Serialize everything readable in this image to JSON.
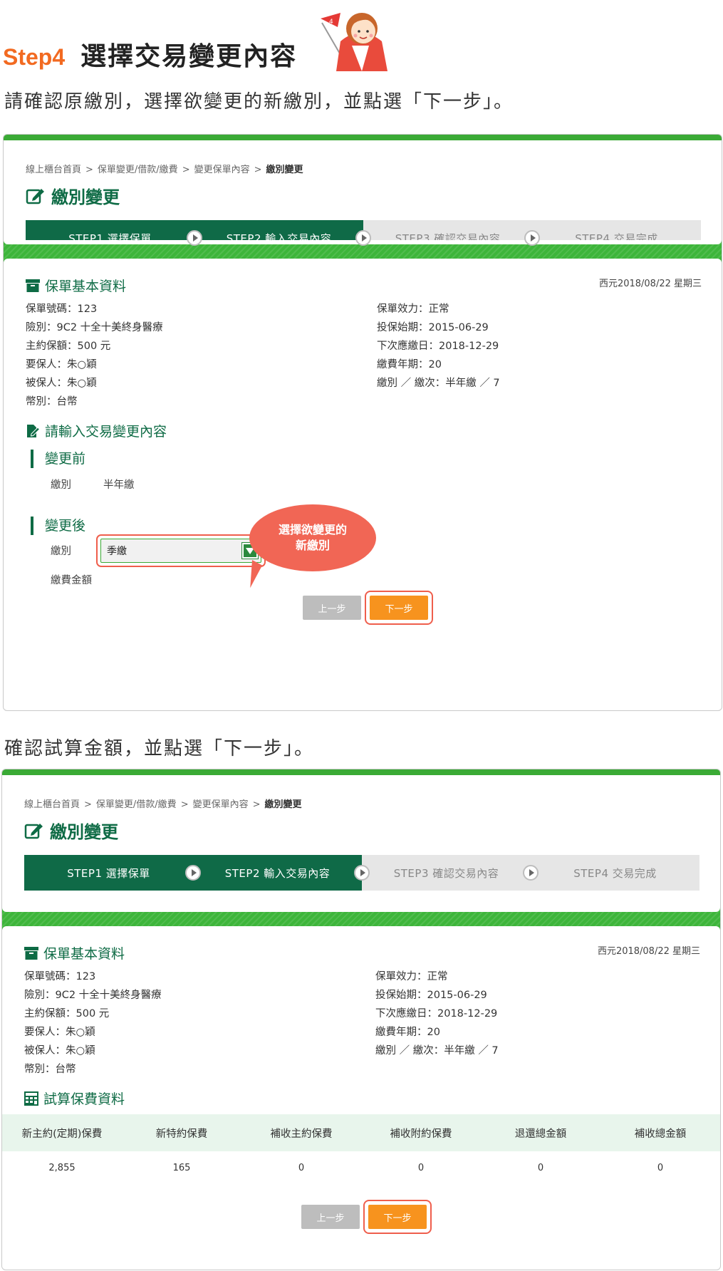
{
  "header": {
    "step_number": "Step4",
    "title": "選擇交易變更內容",
    "mascot_flag": "4"
  },
  "instructions": {
    "first": "請確認原繳別，選擇欲變更的新繳別，並點選「下一步」。",
    "second": "確認試算金額，並點選「下一步」。"
  },
  "breadcrumb": {
    "items": [
      "線上櫃台首頁",
      "保單變更/借款/繳費",
      "變更保單內容"
    ],
    "current": "繳別變更",
    "separator": ">"
  },
  "page_title": "繳別變更",
  "steps": [
    {
      "label": "STEP1 選擇保單",
      "active": true
    },
    {
      "label": "STEP2 輸入交易內容",
      "active": true
    },
    {
      "label": "STEP3 確認交易內容",
      "active": false
    },
    {
      "label": "STEP4 交易完成",
      "active": false
    }
  ],
  "policy": {
    "section_title": "保單基本資料",
    "date": "西元2018/08/22 星期三",
    "left": [
      "保單號碼：123",
      "險別：9C2 十全十美終身醫療",
      "主約保額：500 元",
      "要保人：朱○穎",
      "被保人：朱○穎",
      "幣別：台幣"
    ],
    "right": [
      "保單效力：正常",
      "投保始期：2015-06-29",
      "下次應繳日：2018-12-29",
      "繳費年期：20",
      "繳別 ／ 繳次：半年繳 ／ 7"
    ]
  },
  "change": {
    "section_title": "請輸入交易變更內容",
    "before_title": "變更前",
    "before_label": "繳別",
    "before_value": "半年繳",
    "after_title": "變更後",
    "after_label": "繳別",
    "after_select_value": "季繳",
    "amount_label": "繳費金額"
  },
  "callout": {
    "line1": "選擇欲變更的",
    "line2": "新繳別"
  },
  "buttons": {
    "prev": "上一步",
    "next": "下一步"
  },
  "calc": {
    "section_title": "試算保費資料",
    "headers": [
      "新主約(定期)保費",
      "新特約保費",
      "補收主約保費",
      "補收附約保費",
      "退還總金額",
      "補收總金額"
    ],
    "values": [
      "2,855",
      "165",
      "0",
      "0",
      "0",
      "0"
    ]
  },
  "colors": {
    "brand_green": "#0f6a47",
    "band_green": "#3db53a",
    "accent_orange": "#f7931e",
    "highlight_red": "#ef5e4c",
    "step_title_orange": "#f26a21"
  }
}
